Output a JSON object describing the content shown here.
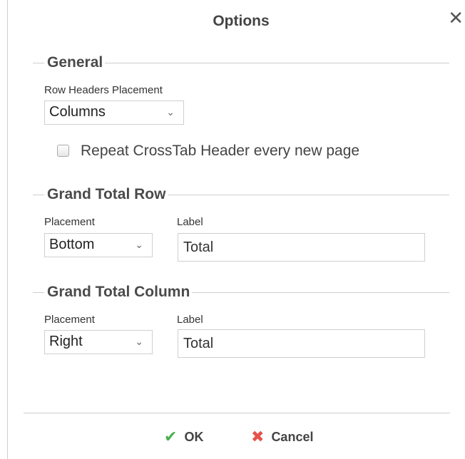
{
  "dialog": {
    "title": "Options",
    "close_glyph": "✕"
  },
  "general": {
    "legend": "General",
    "row_headers_placement_label": "Row Headers Placement",
    "row_headers_placement_value": "Columns",
    "repeat_header_label": "Repeat CrossTab Header every new page",
    "repeat_header_checked": false
  },
  "grand_total_row": {
    "legend": "Grand Total Row",
    "placement_label": "Placement",
    "placement_value": "Bottom",
    "label_label": "Label",
    "label_value": "Total"
  },
  "grand_total_column": {
    "legend": "Grand Total Column",
    "placement_label": "Placement",
    "placement_value": "Right",
    "label_label": "Label",
    "label_value": "Total"
  },
  "footer": {
    "ok_label": "OK",
    "ok_icon": "check-icon",
    "cancel_label": "Cancel",
    "cancel_icon": "x-icon",
    "ok_color": "#4caf50",
    "cancel_color": "#e5534b"
  }
}
